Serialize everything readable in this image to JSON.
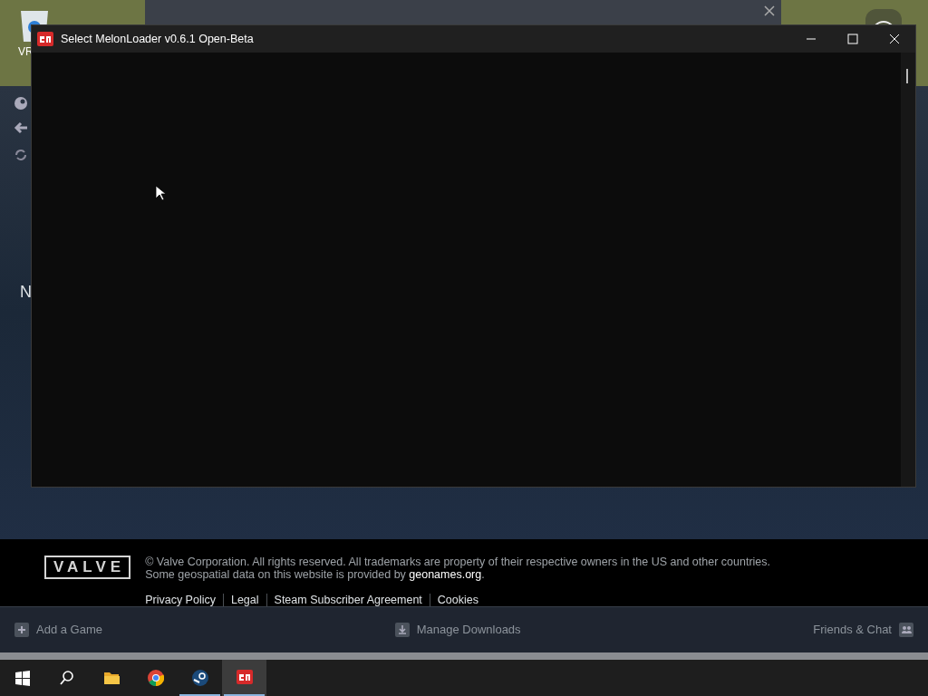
{
  "desktop": {
    "icon_label": "VR"
  },
  "steam": {
    "partial_heading": "N",
    "footer": {
      "logo": "VALVE",
      "copyright": "© Valve Corporation. All rights reserved. All trademarks are property of their respective owners in the US and other countries.",
      "geodata": {
        "before": "Some geospatial data on this website is provided by ",
        "link": "geonames.org",
        "after": "."
      },
      "links": [
        "Privacy Policy",
        "Legal",
        "Steam Subscriber Agreement",
        "Cookies"
      ]
    },
    "bottom_bar": {
      "add_game": "Add a Game",
      "downloads": "Manage Downloads",
      "friends": "Friends & Chat"
    }
  },
  "dialog": {
    "title": "Select MelonLoader v0.6.1 Open-Beta"
  },
  "taskbar": {
    "apps": [
      {
        "kind": "start",
        "running": false,
        "selected": false
      },
      {
        "kind": "search",
        "running": false,
        "selected": false
      },
      {
        "kind": "folder",
        "running": false,
        "selected": false
      },
      {
        "kind": "chrome",
        "running": false,
        "selected": false
      },
      {
        "kind": "steam",
        "running": true,
        "selected": false
      },
      {
        "kind": "melon",
        "running": true,
        "selected": true
      }
    ]
  }
}
